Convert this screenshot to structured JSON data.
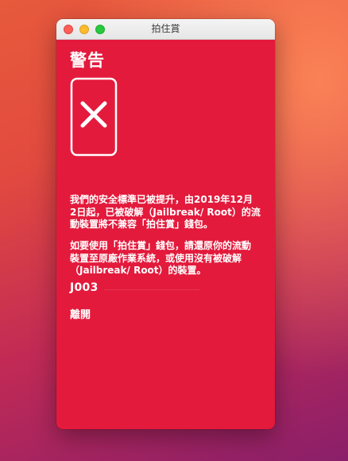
{
  "window": {
    "title": "拍住賞"
  },
  "alert": {
    "heading": "警告",
    "icon": "phone-cross-icon",
    "message_1": "我們的安全標準已被提升，由2019年12月\n2日起，已被破解（Jailbreak/ Root）的流\n動裝置將不兼容「拍住賞」錢包。",
    "message_2": "如要使用「拍住賞」錢包，請還原你的流動\n裝置至原廠作業系統，或使用沒有被破解\n（Jailbreak/ Root）的裝置。",
    "code": "J003",
    "leave_label": "離開"
  },
  "colors": {
    "alert_background": "#e31a3c",
    "text": "#ffffff",
    "traffic_close": "#fc5f57",
    "traffic_minimize": "#fdbc2e",
    "traffic_zoom": "#28c840"
  }
}
